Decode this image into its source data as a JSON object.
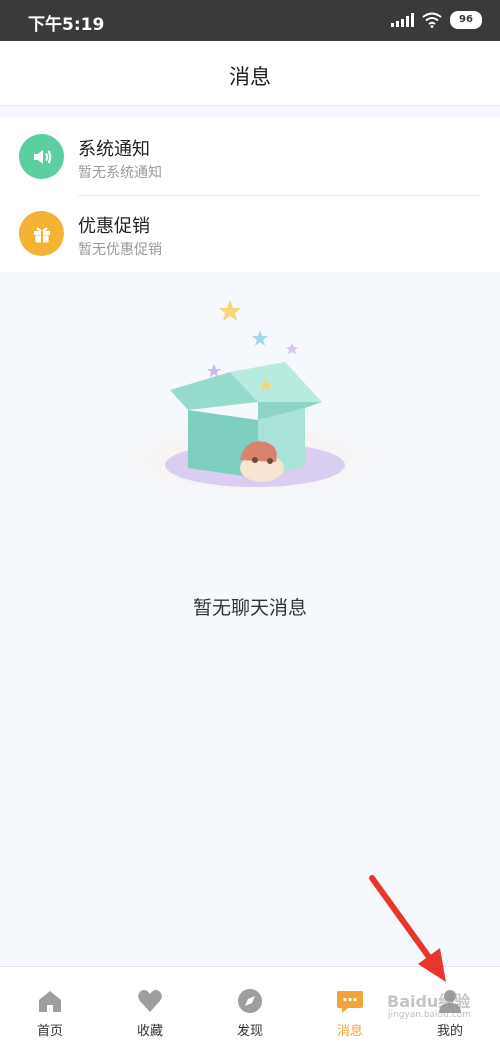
{
  "status_bar": {
    "time": "下午5:19",
    "battery": "96"
  },
  "header": {
    "title": "消息"
  },
  "notices": [
    {
      "title": "系统通知",
      "subtitle": "暂无系统通知",
      "icon": "speaker-icon",
      "color": "#5ccfa0"
    },
    {
      "title": "优惠促销",
      "subtitle": "暂无优惠促销",
      "icon": "gift-icon",
      "color": "#f5b335"
    }
  ],
  "empty": {
    "text": "暂无聊天消息"
  },
  "tabs": [
    {
      "label": "首页",
      "icon": "home-icon",
      "active": false
    },
    {
      "label": "收藏",
      "icon": "heart-icon",
      "active": false
    },
    {
      "label": "发现",
      "icon": "compass-icon",
      "active": false
    },
    {
      "label": "消息",
      "icon": "message-icon",
      "active": true
    },
    {
      "label": "我的",
      "icon": "person-icon",
      "active": false
    }
  ],
  "colors": {
    "accent": "#f2a33a",
    "tab_inactive": "#9e9e9e"
  },
  "watermark": {
    "text": "Baidu经验",
    "sub": "jingyan.baidu.com"
  }
}
